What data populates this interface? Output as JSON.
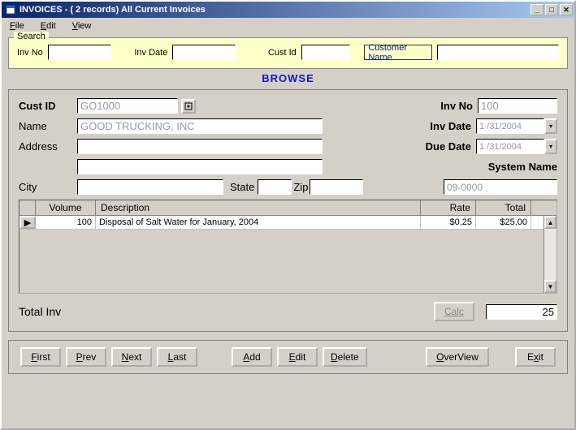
{
  "title": "INVOICES  - ( 2 records)  All Current Invoices",
  "menu": {
    "file": "File",
    "edit": "Edit",
    "view": "View"
  },
  "search": {
    "legend": "Search",
    "inv_no_lbl": "Inv No",
    "inv_no": "",
    "inv_date_lbl": "Inv Date",
    "inv_date": "",
    "cust_id_lbl": "Cust Id",
    "cust_id": "",
    "cust_name_lbl": "Customer Name",
    "cust_name": ""
  },
  "browse_label": "BROWSE",
  "form": {
    "cust_id_lbl": "Cust ID",
    "cust_id": "GO1000",
    "name_lbl": "Name",
    "name": "GOOD TRUCKING, INC",
    "address_lbl": "Address",
    "address1": "",
    "address2": "",
    "city_lbl": "City",
    "city": "",
    "state_lbl": "State",
    "state": "",
    "zip_lbl": "Zip",
    "zip": "",
    "inv_no_lbl": "Inv No",
    "inv_no": "100",
    "inv_date_lbl": "Inv Date",
    "inv_date": "1 /31/2004",
    "due_date_lbl": "Due Date",
    "due_date": "1 /31/2004",
    "system_name_lbl": "System Name",
    "system_name": "09-0000"
  },
  "grid": {
    "headers": {
      "volume": "Volume",
      "description": "Description",
      "rate": "Rate",
      "total": "Total"
    },
    "rows": [
      {
        "volume": "100",
        "description": "Disposal of Salt Water for January, 2004",
        "rate": "$0.25",
        "total": "$25.00"
      }
    ]
  },
  "total_inv_lbl": "Total Inv",
  "calc_label": "Calc",
  "total_inv_value": "25",
  "nav": {
    "first": "First",
    "prev": "Prev",
    "next": "Next",
    "last": "Last",
    "add": "Add",
    "edit": "Edit",
    "delete": "Delete",
    "overview": "OverView",
    "exit": "Exit"
  }
}
